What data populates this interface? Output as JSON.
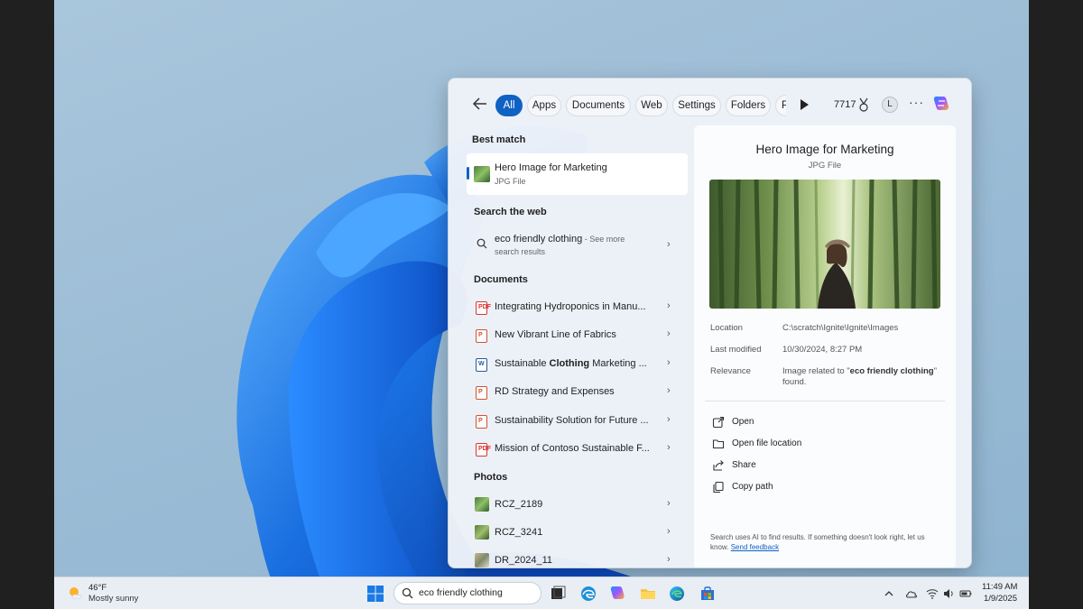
{
  "search_flyout": {
    "filters": [
      "All",
      "Apps",
      "Documents",
      "Web",
      "Settings",
      "Folders",
      "P"
    ],
    "points": "7717",
    "user_initial": "L",
    "more": "···",
    "sections": {
      "best_match": "Best match",
      "search_web": "Search the web",
      "documents": "Documents",
      "photos": "Photos"
    },
    "best_match": {
      "title": "Hero Image for Marketing",
      "subtitle": "JPG File"
    },
    "web_result": {
      "query": "eco friendly clothing",
      "suffix": " - See more",
      "suffix2": "search results"
    },
    "documents": [
      {
        "label": "Integrating Hydroponics in Manu...",
        "type": "pdf"
      },
      {
        "label": "New Vibrant Line of Fabrics",
        "type": "ppt"
      },
      {
        "label_pre": "Sustainable ",
        "label_bold": "Clothing",
        "label_post": " Marketing ...",
        "type": "word"
      },
      {
        "label": "RD Strategy and Expenses",
        "type": "ppt"
      },
      {
        "label": "Sustainability Solution for Future ...",
        "type": "ppt"
      },
      {
        "label": "Mission of Contoso Sustainable F...",
        "type": "pdf"
      }
    ],
    "photos": [
      "RCZ_2189",
      "RCZ_3241",
      "DR_2024_11"
    ],
    "preview": {
      "title": "Hero Image for Marketing",
      "subtitle": "JPG File",
      "location_label": "Location",
      "location_value": "C:\\scratch\\Ignite\\Ignite\\Images",
      "modified_label": "Last modified",
      "modified_value": "10/30/2024, 8:27 PM",
      "relevance_label": "Relevance",
      "relevance_pre": "Image related to \"",
      "relevance_bold": "eco friendly clothing",
      "relevance_post": "\" found.",
      "actions": [
        "Open",
        "Open file location",
        "Share",
        "Copy path"
      ],
      "footer_text": "Search uses AI to find results. If something doesn't look right, let us know.",
      "footer_link": "Send feedback"
    }
  },
  "taskbar": {
    "weather_temp": "46°F",
    "weather_desc": "Mostly sunny",
    "search_value": "eco friendly clothing",
    "time": "11:49 AM",
    "date": "1/9/2025"
  },
  "colors": {
    "accent": "#0f62c4",
    "wallpaper": "#9dbdd6",
    "bloom": "#1a6fe0"
  }
}
